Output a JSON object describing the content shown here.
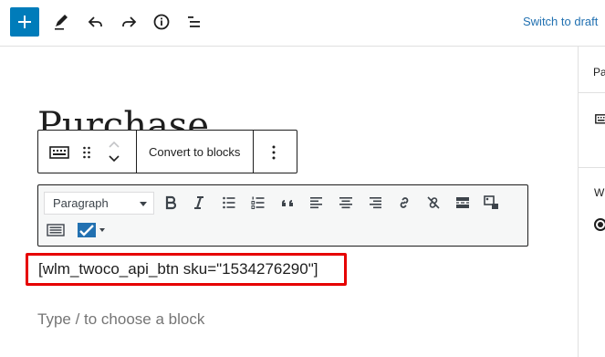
{
  "header": {
    "add_block": "plus-icon",
    "tools": [
      "pencil-icon",
      "undo-icon",
      "redo-icon",
      "info-icon",
      "list-view-icon"
    ],
    "switch_to_draft": "Switch to draft"
  },
  "sidebar": {
    "tab_label": "Pa",
    "section_label": "W"
  },
  "editor": {
    "title_visible": "Purchase",
    "block_toolbar": {
      "convert_label": "Convert to blocks"
    },
    "classic_toolbar": {
      "format_value": "Paragraph"
    },
    "shortcode": "[wlm_twoco_api_btn sku=\"1534276290\"]",
    "appender_placeholder": "Type / to choose a block"
  },
  "colors": {
    "accent": "#007cba",
    "link": "#2271b1",
    "highlight": "#e60000"
  }
}
